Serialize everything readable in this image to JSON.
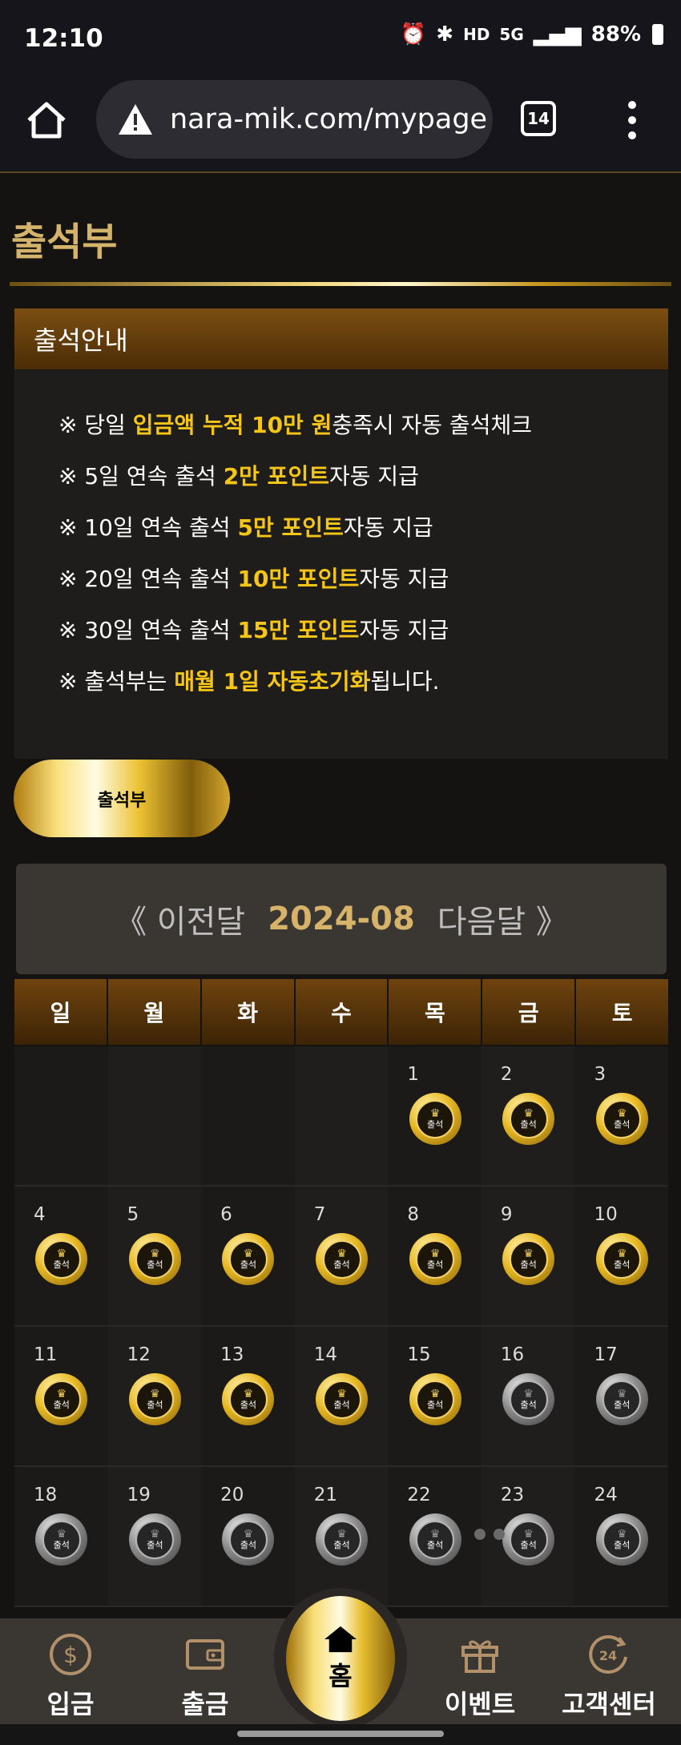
{
  "status": {
    "time": "12:10",
    "net_hd": "HD",
    "net_5g": "5G",
    "battery": "88%"
  },
  "browser": {
    "url": "nara-mik.com/mypage",
    "tab_count": "14"
  },
  "page": {
    "title": "출석부"
  },
  "guide": {
    "heading": "출석안내",
    "items": [
      {
        "pre": "※ 당일 ",
        "hl": "입금액 누적 10만 원",
        "post": "충족시 자동 출석체크"
      },
      {
        "pre": "※ 5일 연속 출석 ",
        "hl": "2만 포인트",
        "post": "자동 지급"
      },
      {
        "pre": "※ 10일 연속 출석 ",
        "hl": "5만 포인트",
        "post": "자동 지급"
      },
      {
        "pre": "※ 20일 연속 출석 ",
        "hl": "10만 포인트",
        "post": "자동 지급"
      },
      {
        "pre": "※ 30일 연속 출석 ",
        "hl": "15만 포인트",
        "post": "자동 지급"
      },
      {
        "pre": "※ 출석부는 ",
        "hl": "매월 1일 자동초기화",
        "post": "됩니다."
      }
    ]
  },
  "attendance_button": "출석부",
  "calendar": {
    "prev": "《 이전달",
    "current": "2024-08",
    "next": "다음달 》",
    "weekdays": [
      "일",
      "월",
      "화",
      "수",
      "목",
      "금",
      "토"
    ],
    "stamp_label": "출석",
    "weeks": [
      [
        {
          "d": ""
        },
        {
          "d": ""
        },
        {
          "d": ""
        },
        {
          "d": ""
        },
        {
          "d": "1",
          "s": "gold"
        },
        {
          "d": "2",
          "s": "gold"
        },
        {
          "d": "3",
          "s": "gold"
        }
      ],
      [
        {
          "d": "4",
          "s": "gold"
        },
        {
          "d": "5",
          "s": "gold"
        },
        {
          "d": "6",
          "s": "gold"
        },
        {
          "d": "7",
          "s": "gold"
        },
        {
          "d": "8",
          "s": "gold"
        },
        {
          "d": "9",
          "s": "gold"
        },
        {
          "d": "10",
          "s": "gold"
        }
      ],
      [
        {
          "d": "11",
          "s": "gold"
        },
        {
          "d": "12",
          "s": "gold"
        },
        {
          "d": "13",
          "s": "gold"
        },
        {
          "d": "14",
          "s": "gold"
        },
        {
          "d": "15",
          "s": "gold"
        },
        {
          "d": "16",
          "s": "gray"
        },
        {
          "d": "17",
          "s": "gray"
        }
      ],
      [
        {
          "d": "18",
          "s": "gray"
        },
        {
          "d": "19",
          "s": "gray"
        },
        {
          "d": "20",
          "s": "gray"
        },
        {
          "d": "21",
          "s": "gray"
        },
        {
          "d": "22",
          "s": "gray"
        },
        {
          "d": "23",
          "s": "gray"
        },
        {
          "d": "24",
          "s": "gray"
        }
      ]
    ]
  },
  "bottom_nav": {
    "deposit": "입금",
    "withdraw": "출금",
    "home": "홈",
    "event": "이벤트",
    "support": "고객센터"
  }
}
